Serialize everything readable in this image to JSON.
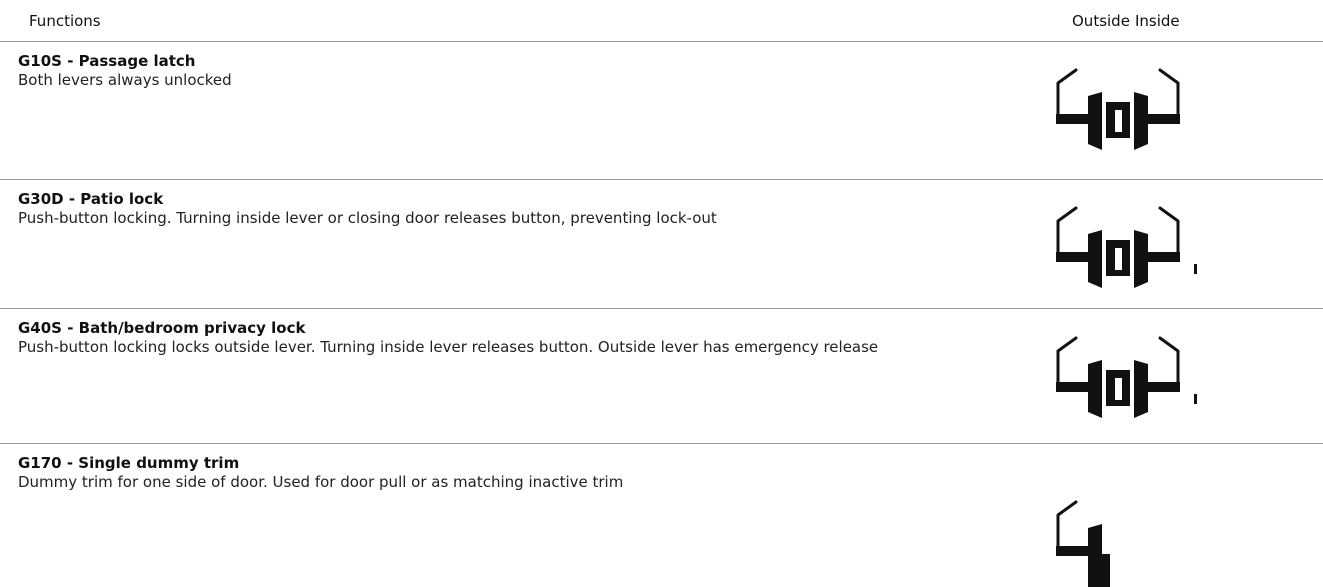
{
  "header": {
    "functions_label": "Functions",
    "outside_label": "Outside",
    "inside_label": "Inside"
  },
  "rows": [
    {
      "code_title": "G10S - Passage latch",
      "description": "Both levers always unlocked",
      "icon": "passage-latch-diagram-icon"
    },
    {
      "code_title": "G30D - Patio lock",
      "description": "Push-button locking. Turning inside lever or closing door releases button, preventing lock-out",
      "icon": "patio-lock-diagram-icon"
    },
    {
      "code_title": "G40S - Bath/bedroom privacy lock",
      "description": "Push-button locking locks outside lever. Turning inside lever releases button. Outside lever has emergency release",
      "icon": "privacy-lock-diagram-icon"
    },
    {
      "code_title": "G170 - Single dummy trim",
      "description": "Dummy trim for one side of door. Used for door pull or as matching inactive trim",
      "icon": "dummy-trim-diagram-icon"
    }
  ],
  "colors": {
    "text": "#111111",
    "rule": "#9a9a9a",
    "diagram": "#111111"
  }
}
